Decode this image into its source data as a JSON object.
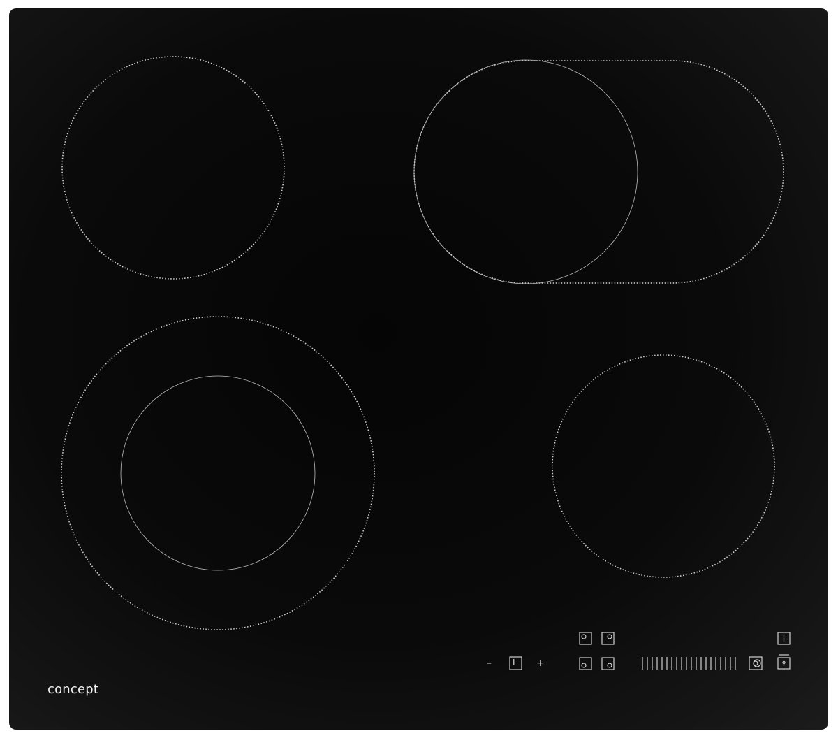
{
  "brand": {
    "logo_text": "concept"
  },
  "controls": {
    "minus_label": "–",
    "plus_label": "+",
    "timer_label": "L"
  },
  "colors": {
    "glass": "#0a0a0a",
    "print": "#d8d8d8"
  },
  "icons": {
    "zone_select": "zone-select-icon",
    "slider": "power-slider-icon",
    "dual_zone": "dual-zone-icon",
    "power": "power-icon",
    "lock": "lock-icon"
  }
}
